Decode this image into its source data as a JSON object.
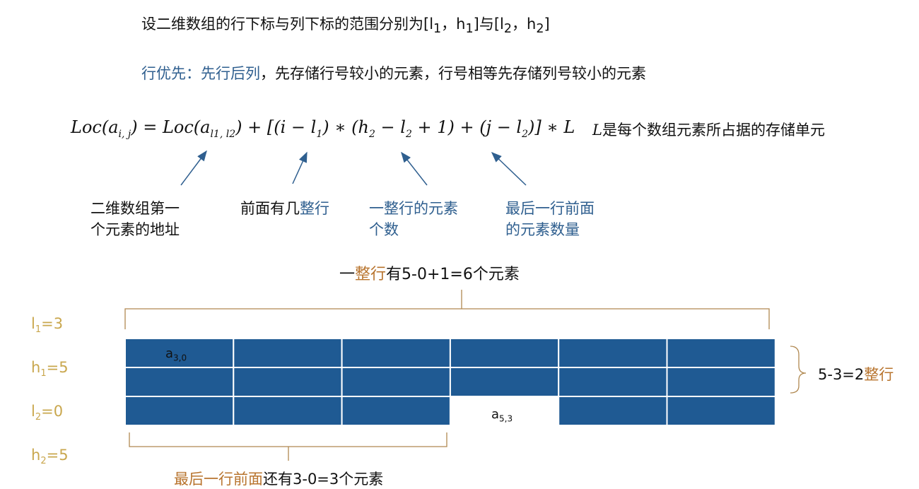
{
  "heading": {
    "prefix": "设二维数组的行下标与列下标的范围分别为[l",
    "l1_sub": "1",
    "comma1": "，h",
    "h1_sub": "1",
    "mid": "]与[l",
    "l2_sub": "2",
    "comma2": "，h",
    "h2_sub": "2",
    "end": "]"
  },
  "row_major": {
    "term": "行优先：先行后列",
    "desc": "，先存储行号较小的元素，行号相等先存储列号较小的元素"
  },
  "formula": {
    "lhs": "Loc(a",
    "lhs_sub": "i, j",
    "eq": ") = Loc(a",
    "base_sub": "l1, l2",
    "part1": ") + [(i − l",
    "s1": "1",
    "part2": ") ∗ (h",
    "s2": "2",
    "part3": " − l",
    "s3": "2",
    "part4": " + 1) + (j − l",
    "s4": "2",
    "part5": ")] ∗ L"
  },
  "L_note": {
    "symbol": "L",
    "text": "是每个数组元素所占据的存储单元"
  },
  "annotations": {
    "base_line1": "二维数组第一",
    "base_line2": "个元素的地址",
    "rows_before_a": "前面有几",
    "rows_before_b": "整行",
    "elements_per_row_line1": "一整行的元素",
    "elements_per_row_line2": "个数",
    "last_row_line1": "最后一行前面",
    "last_row_line2": "的元素数量"
  },
  "row_count": {
    "a": "一",
    "b": "整行",
    "c": "有5-0+1=6个元素"
  },
  "bounds": [
    {
      "name": "l",
      "sub": "1",
      "value": "=3"
    },
    {
      "name": "h",
      "sub": "1",
      "value": "=5"
    },
    {
      "name": "l",
      "sub": "2",
      "value": "=0"
    },
    {
      "name": "h",
      "sub": "2",
      "value": "=5"
    }
  ],
  "rows_result": {
    "a": "5-3=2",
    "b": "整行"
  },
  "cells": {
    "a30": {
      "name": "a",
      "sub": "3,0"
    },
    "a53": {
      "name": "a",
      "sub": "5,3"
    }
  },
  "bottom_note": {
    "a": "最后一",
    "b": "行前面",
    "c": "还有3-0=3个元素"
  },
  "grid": {
    "columns": 6,
    "full_rows": 2,
    "filled_in_last_row": 3,
    "color": "#1f5a93"
  },
  "colors": {
    "blue_text": "#2f5f8f",
    "orange_text": "#b8742e",
    "gold_text": "#c9a74e"
  }
}
